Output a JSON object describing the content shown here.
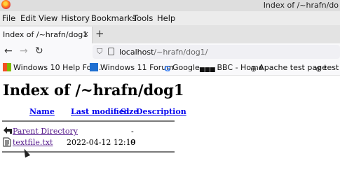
{
  "window": {
    "title": "Index of /~hrafn/do"
  },
  "menu": {
    "items": [
      "File",
      "Edit",
      "View",
      "History",
      "Bookmarks",
      "Tools",
      "Help"
    ]
  },
  "tab": {
    "title": "Index of /~hrafn/dog1",
    "close": "×",
    "new_tab": "+"
  },
  "nav": {
    "back": "←",
    "forward": "→",
    "reload": "↻",
    "url_host": "localhost",
    "url_path": "/~hrafn/dog1/"
  },
  "bookmarks": [
    "Windows 10 Help For...",
    "Windows 11 Forum",
    "Google",
    "BBC - Home",
    "Apache test page",
    "test p"
  ],
  "page": {
    "heading": "Index of /~hrafn/dog1",
    "columns": [
      "Name",
      "Last modified",
      "Size",
      "Description"
    ],
    "rows": [
      {
        "name": "Parent Directory",
        "modified": "",
        "size": "-",
        "description": ""
      },
      {
        "name": "textfile.txt",
        "modified": "2022-04-12 12:19",
        "size": "0",
        "description": ""
      }
    ]
  }
}
